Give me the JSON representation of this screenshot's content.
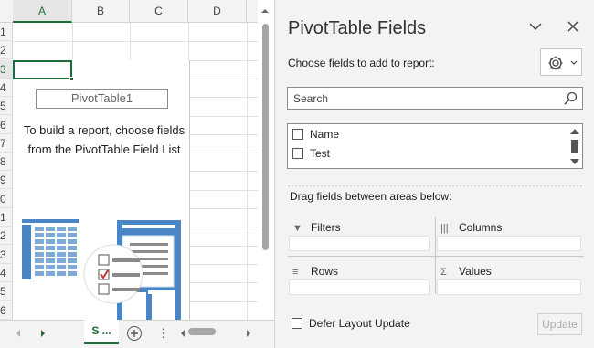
{
  "sheet": {
    "columns": [
      "A",
      "B",
      "C",
      "D"
    ],
    "rows": [
      "1",
      "2",
      "3",
      "4",
      "5",
      "6",
      "7",
      "8",
      "9",
      "0",
      "1",
      "2",
      "3",
      "4",
      "5",
      "6"
    ],
    "pivot_name": "PivotTable1",
    "pivot_message": "To build a report, choose fields from the PivotTable Field List",
    "sheet_tab_label": "S",
    "sheet_tab_more": "..."
  },
  "pane": {
    "title": "PivotTable Fields",
    "choose_label": "Choose fields to add to report:",
    "search_placeholder": "Search",
    "fields": [
      {
        "label": "Name",
        "checked": false
      },
      {
        "label": "Test",
        "checked": false
      }
    ],
    "drag_label": "Drag fields between areas below:",
    "areas": {
      "filters": "Filters",
      "columns": "Columns",
      "rows": "Rows",
      "values": "Values"
    },
    "defer_label": "Defer Layout Update",
    "update_label": "Update"
  },
  "colors": {
    "accent": "#1e6c3b",
    "pane_bg": "#f3f3f3",
    "illustration_blue": "#4a86c5"
  }
}
